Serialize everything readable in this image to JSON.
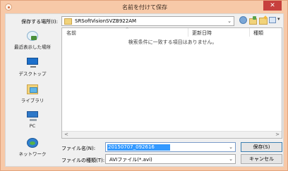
{
  "window": {
    "title": "名前を付けて保存",
    "close_glyph": "✕"
  },
  "toolbar": {
    "save_in_label": "保存する場所(I):",
    "folder_name": "SRSoftVisionSVZB922AM",
    "dropdown_glyph": "⌄",
    "view_glyph": "▾"
  },
  "places": [
    {
      "label": "最近表示した場所",
      "icon": "recent-places-icon"
    },
    {
      "label": "デスクトップ",
      "icon": "desktop-icon"
    },
    {
      "label": "ライブラリ",
      "icon": "libraries-icon"
    },
    {
      "label": "PC",
      "icon": "pc-icon"
    },
    {
      "label": "ネットワーク",
      "icon": "network-icon"
    }
  ],
  "file_list": {
    "columns": [
      "名前",
      "更新日時",
      "種類"
    ],
    "sort_glyph": "^",
    "empty_message": "検索条件に一致する項目はありません。",
    "scroll_left_glyph": "<",
    "scroll_right_glyph": ">"
  },
  "form": {
    "filename_label": "ファイル名(N):",
    "filename_value": "20150707_092616",
    "filetype_label": "ファイルの種類(T):",
    "filetype_value": "AVIファイル(*.avi)",
    "dropdown_glyph": "⌄"
  },
  "buttons": {
    "save": "保存(S)",
    "cancel": "キャンセル"
  }
}
